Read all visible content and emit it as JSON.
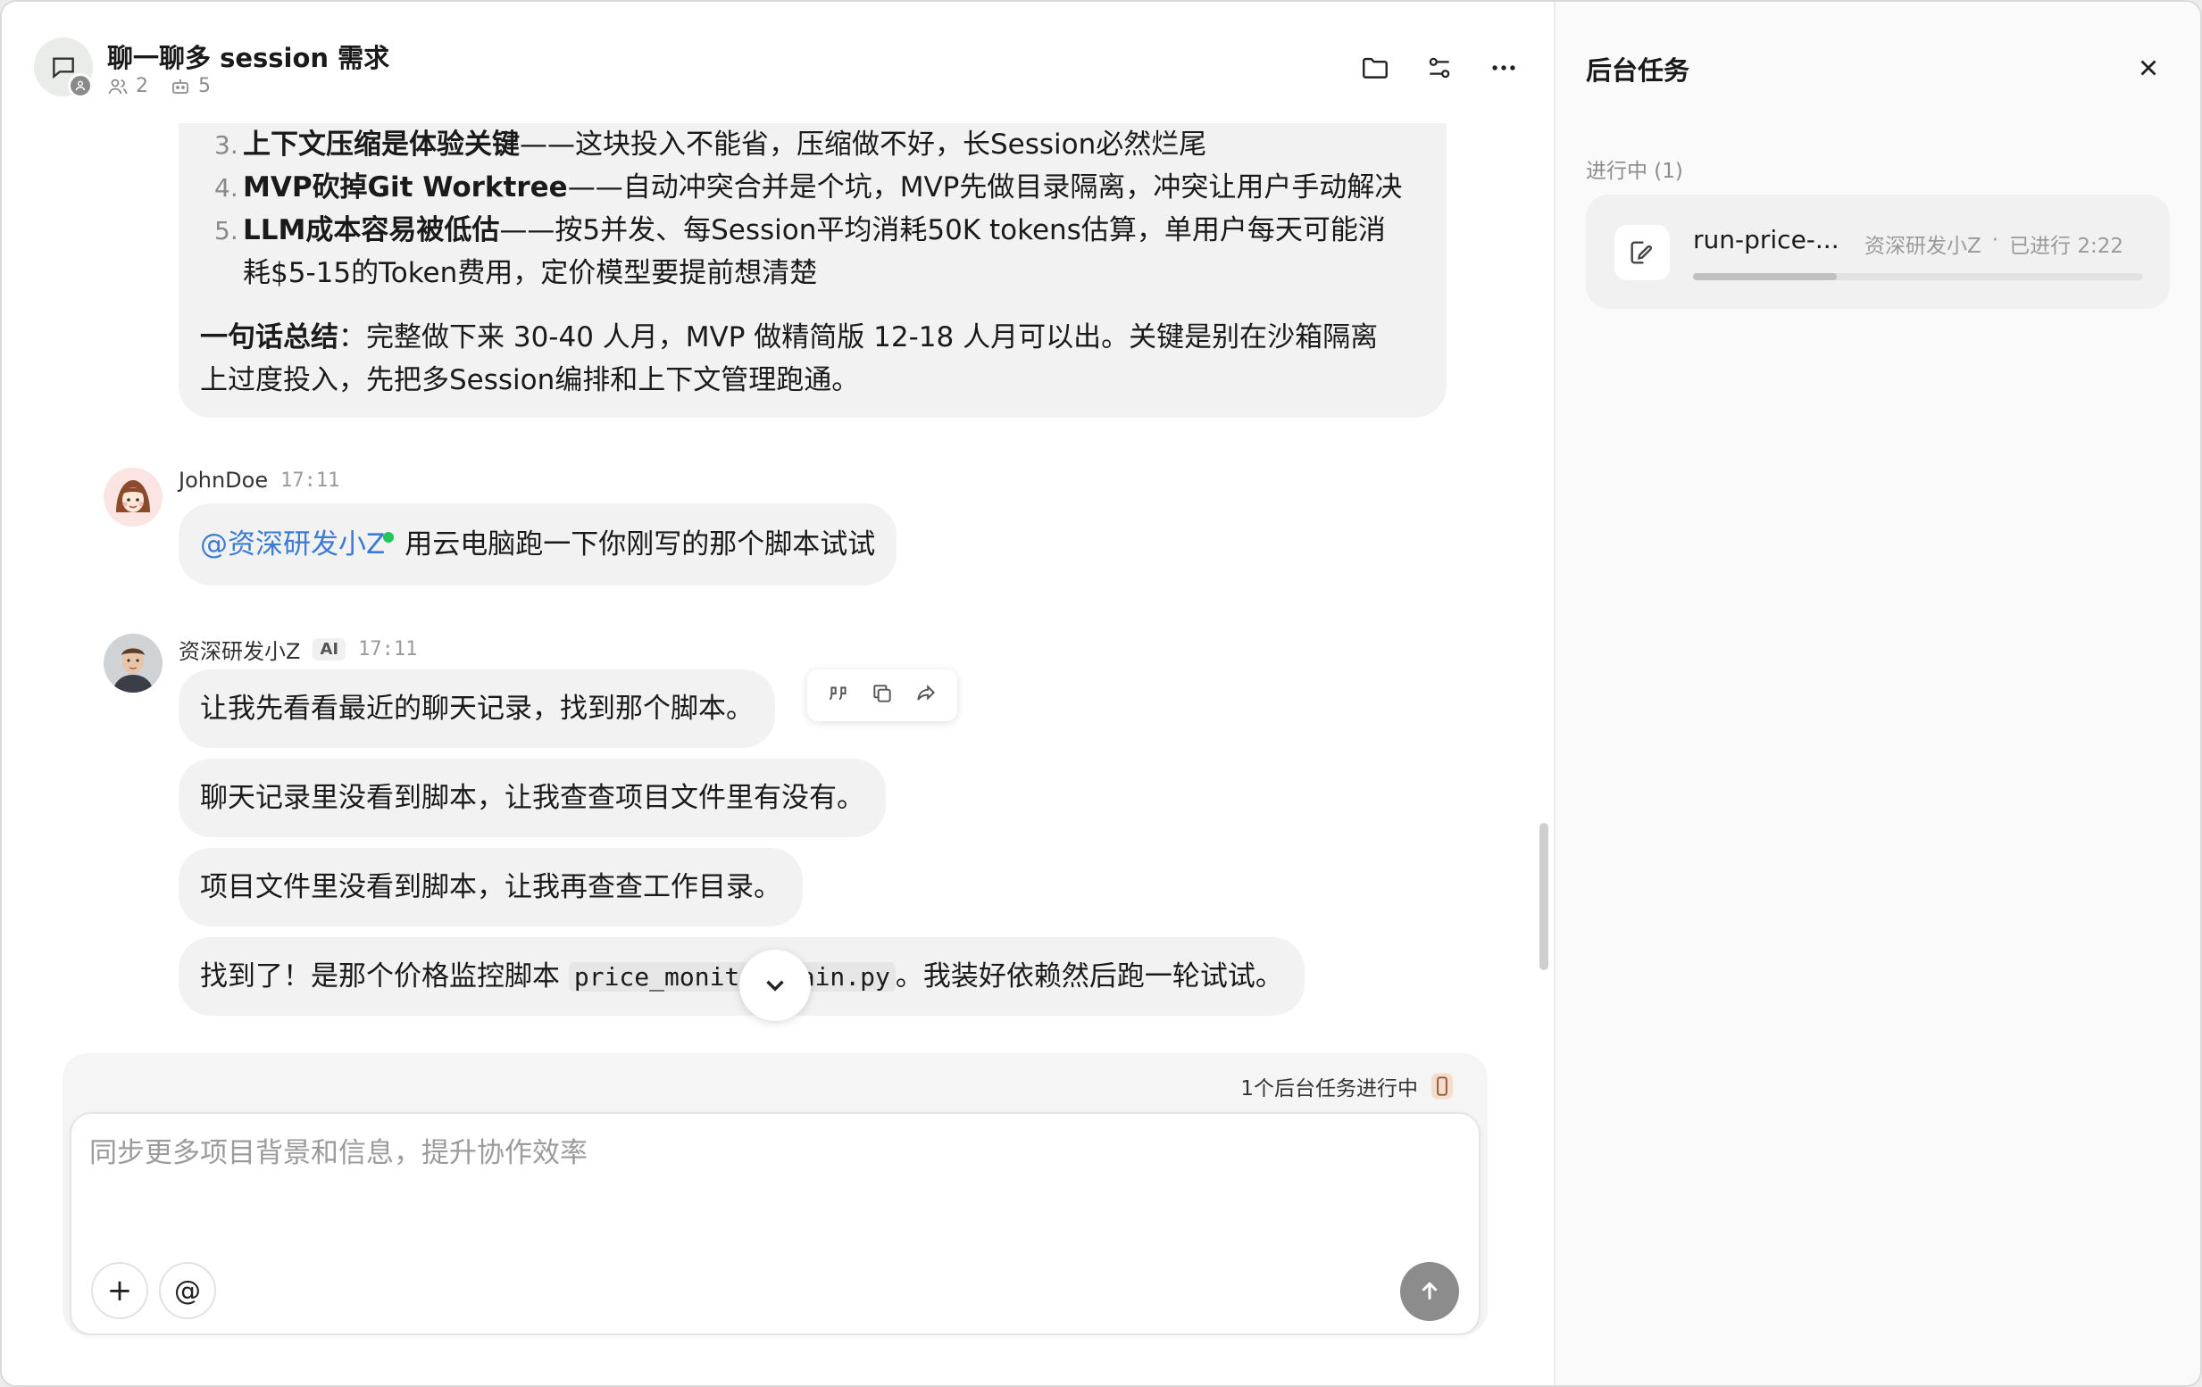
{
  "header": {
    "title": "聊一聊多 session 需求",
    "member_count": "2",
    "bot_count": "5"
  },
  "big_message": {
    "items": [
      {
        "num": "3.",
        "bold": "上下文压缩是体验关键",
        "rest": "——这块投入不能省，压缩做不好，长Session必然烂尾"
      },
      {
        "num": "4.",
        "bold": "MVP砍掉Git Worktree",
        "rest": "——自动冲突合并是个坑，MVP先做目录隔离，冲突让用户手动解决"
      },
      {
        "num": "5.",
        "bold": "LLM成本容易被低估",
        "rest": "——按5并发、每Session平均消耗50K tokens估算，单用户每天可能消"
      },
      {
        "num": "",
        "bold": "",
        "rest": "耗$5-15的Token费用，定价模型要提前想清楚"
      }
    ],
    "summary_bold": "一句话总结",
    "summary_line1": "：完整做下来 30-40 人月，MVP 做精简版 12-18 人月可以出。关键是别在沙箱隔离",
    "summary_line2": "上过度投入，先把多Session编排和上下文管理跑通。"
  },
  "msg_john": {
    "sender": "JohnDoe",
    "time": "17:11",
    "mention": "@资深研发小Z",
    "text": "用云电脑跑一下你刚写的那个脚本试试"
  },
  "msg_ai": {
    "sender": "资深研发小Z",
    "tag": "AI",
    "time": "17:11",
    "bubbles": [
      "让我先看看最近的聊天记录，找到那个脚本。",
      "聊天记录里没看到脚本，让我查查项目文件里有没有。",
      "项目文件里没看到脚本，让我再查查工作目录。"
    ],
    "last_prefix": "找到了！是那个价格监控脚本 ",
    "last_code": "price_monitor/main.py",
    "last_suffix": "。我装好依赖然后跑一轮试试。"
  },
  "composer": {
    "bg_status": "1个后台任务进行中",
    "placeholder": "同步更多项目背景和信息，提升协作效率",
    "add_label": "+",
    "mention_label": "@"
  },
  "panel": {
    "title": "后台任务",
    "section": "进行中 (1)",
    "task": {
      "name": "run-price-...",
      "owner": "资深研发小Z",
      "dot": "·",
      "elapsed": "已进行 2:22",
      "progress": 0.32
    }
  },
  "colors": {
    "mention": "#3a7bd5",
    "online": "#22c55e",
    "send_button": "#8c8c8c"
  },
  "icons": [
    "chat-icon",
    "folder-icon",
    "sliders-icon",
    "more-icon",
    "close-icon",
    "quote-icon",
    "copy-icon",
    "share-icon",
    "chevron-down-icon",
    "arrow-up-icon",
    "edit-icon"
  ]
}
